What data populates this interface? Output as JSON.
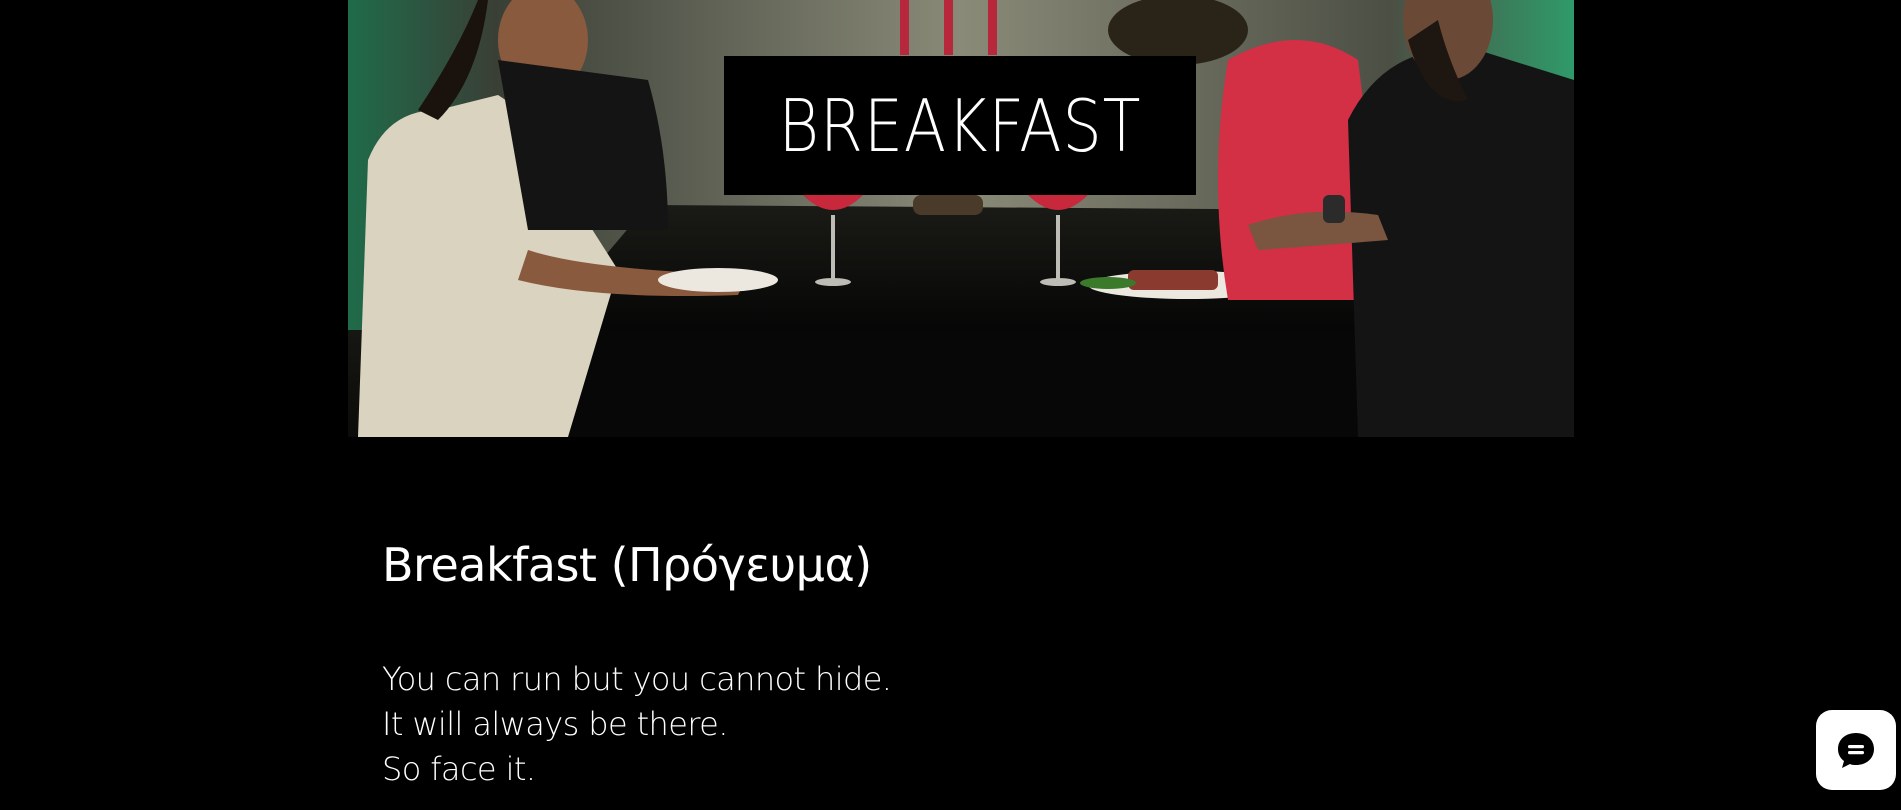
{
  "hero": {
    "title": "BREAKFAST",
    "image_description_icon": "dinner-table-photo"
  },
  "post": {
    "title": "Breakfast (Πρόγευμα)",
    "lines": [
      "You can run but you cannot hide.",
      "It will always be there.",
      "So face it."
    ]
  },
  "chat": {
    "icon": "chat-bubble-icon"
  },
  "colors": {
    "background": "#000000",
    "text": "#ffffff",
    "title_box": "#000000",
    "wall_green": "#2f9a6a",
    "shirt_red": "#d32f45"
  }
}
